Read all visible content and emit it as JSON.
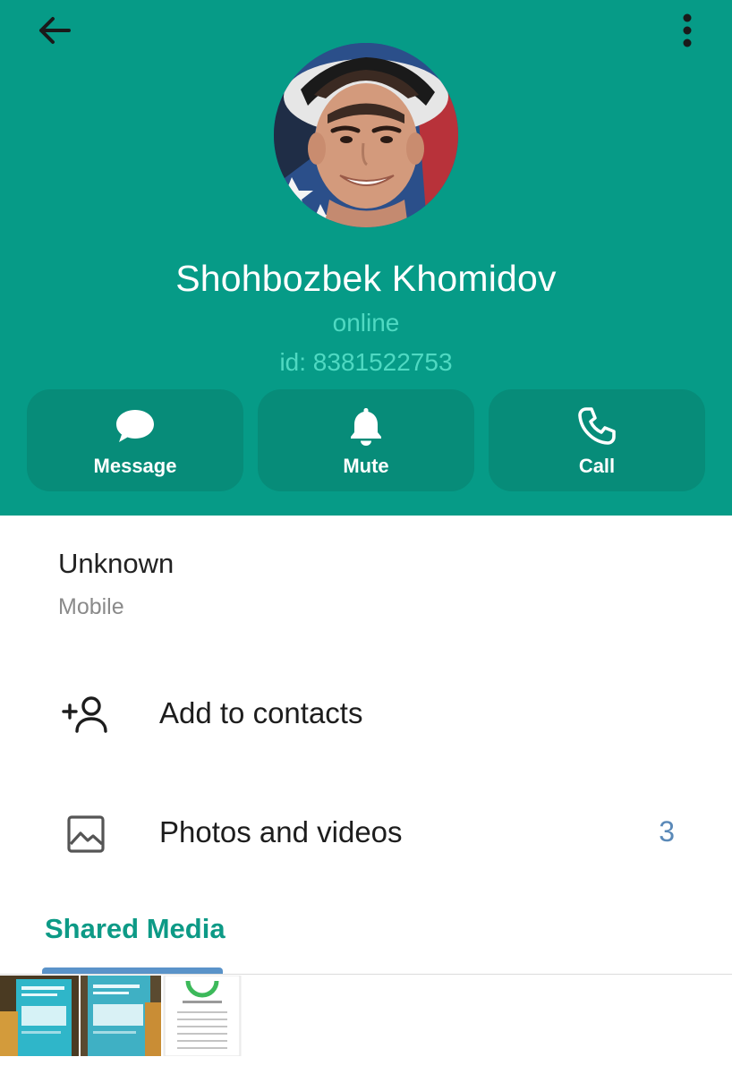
{
  "header": {
    "background_color": "#069b87",
    "back_icon": "arrow-left-icon",
    "menu_icon": "more-vertical-icon"
  },
  "profile": {
    "name": "Shohbozbek Khomidov",
    "status": "online",
    "id_text": "id: 8381522753"
  },
  "actions": [
    {
      "label": "Message",
      "icon": "chat-bubble-icon"
    },
    {
      "label": "Mute",
      "icon": "bell-icon"
    },
    {
      "label": "Call",
      "icon": "phone-icon"
    }
  ],
  "info": {
    "title": "Unknown",
    "subtitle": "Mobile"
  },
  "rows": {
    "add_contacts": {
      "label": "Add to contacts",
      "icon": "add-person-icon"
    },
    "photos_videos": {
      "label": "Photos and videos",
      "count": "3",
      "icon": "image-icon"
    }
  },
  "shared_media": {
    "title": "Shared Media",
    "thumbnail_count": 3
  },
  "colors": {
    "accent": "#069b87",
    "button": "#078c79",
    "status_text": "#4fd9c2",
    "count_text": "#5a89b8",
    "tab_indicator": "#5a93c9"
  }
}
